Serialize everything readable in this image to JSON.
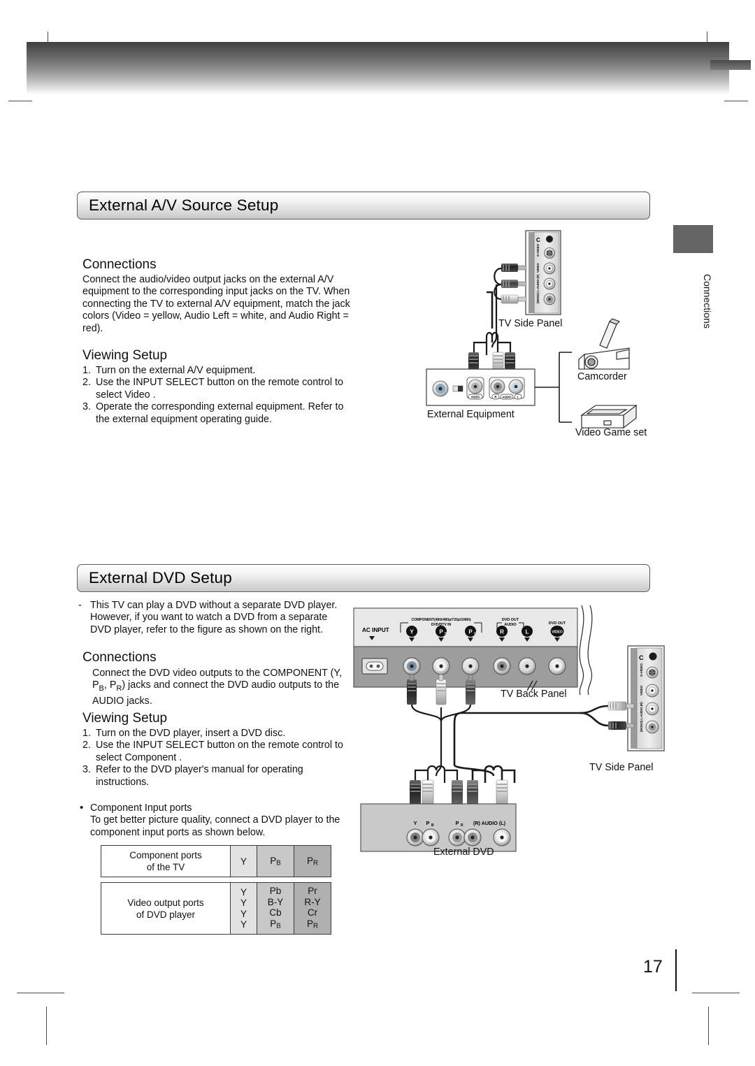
{
  "page": {
    "number": "17",
    "margin_tab": "Connections"
  },
  "section1": {
    "title": "External A/V Source Setup",
    "connections_heading": "Connections",
    "connections_body": "Connect the audio/video output jacks on the external A/V equipment to the corresponding input jacks on the TV. When connecting the TV to external A/V equipment, match the jack colors (Video = yellow, Audio Left = white, and Audio Right = red).",
    "viewing_heading": "Viewing Setup",
    "steps": [
      {
        "num": "1.",
        "text": "Turn on the external A/V equipment."
      },
      {
        "num": "2.",
        "text": "Use the INPUT SELECT button on the remote control to select Video ."
      },
      {
        "num": "3.",
        "text": "Operate the corresponding external equipment. Refer to the external equipment operating guide."
      }
    ],
    "diagram": {
      "caption_tv_side_panel": "TV Side Panel",
      "caption_external_equipment": "External Equipment",
      "caption_camcorder": "Camcorder",
      "caption_video_game": "Video Game set",
      "side_panel_labels": [
        "S-VIDEO",
        "VIDEO",
        "(MONO) L-AUDIO-(R)"
      ],
      "side_panel_headphone": "C",
      "equipment_labels": {
        "video": "VIDEO",
        "audio": "(R)  AUDIO  (L)"
      }
    }
  },
  "section2": {
    "title": "External DVD  Setup",
    "intro_dash": "-",
    "intro": "This TV can play a DVD without a separate DVD player. However, if you want to watch a DVD from a separate  DVD player, refer to the figure as shown on the right.",
    "connections_heading": "Connections",
    "connections_body_pre": "Connect the DVD video outputs to the COMPONENT (Y, P",
    "connections_body_sub1": "B",
    "connections_body_mid": ", P",
    "connections_body_sub2": "R",
    "connections_body_post": ") jacks and connect the DVD audio outputs to the AUDIO jacks.",
    "viewing_heading": "Viewing Setup",
    "steps": [
      {
        "num": "1.",
        "text": "Turn on the DVD player, insert a DVD disc."
      },
      {
        "num": "2.",
        "text": "Use the INPUT SELECT button on the remote control to select Component ."
      },
      {
        "num": "3.",
        "text": "Refer to the DVD player's manual for operating instructions."
      }
    ],
    "bullet": {
      "title": "Component Input ports",
      "text": "To get better picture quality, connect a DVD player to the component input ports as shown below."
    },
    "table1": {
      "row_label_line1": "Component ports",
      "row_label_line2": "of the TV",
      "cols": [
        "Y",
        "PB",
        "PR"
      ]
    },
    "table2": {
      "row_label_line1": "Video output ports",
      "row_label_line2": "of DVD player",
      "col1": [
        "Y",
        "Y",
        "Y",
        "Y"
      ],
      "col2": [
        "Pb",
        "B-Y",
        "Cb",
        "PB"
      ],
      "col3": [
        "Pr",
        "R-Y",
        "Cr",
        "PR"
      ]
    },
    "diagram": {
      "caption_tv_back_panel": "TV Back Panel",
      "caption_tv_side_panel": "TV Side Panel",
      "caption_external_dvd": "External DVD",
      "back_panel": {
        "ac_input": "AC INPUT",
        "component_line1": "COMPONENT(480i/480p/720p/1080i)",
        "component_line2": "DVD/DTV IN",
        "component_jacks": [
          "Y",
          "PB",
          "PR"
        ],
        "dvd_out_audio_line1": "DVD OUT",
        "dvd_out_audio_line2": "AUDIO",
        "dvd_out_audio_jacks": [
          "R",
          "L"
        ],
        "dvd_out_video_label": "DVD OUT",
        "dvd_out_video_jack": "VIDEO"
      },
      "side_panel_labels": [
        "S-VIDEO",
        "VIDEO",
        "(MONO) L-AUDIO-(R)"
      ],
      "side_panel_headphone": "C",
      "dvd_labels": {
        "y": "Y",
        "pb": "PB",
        "pr": "PR",
        "audio": "(R) AUDIO (L)"
      }
    }
  }
}
